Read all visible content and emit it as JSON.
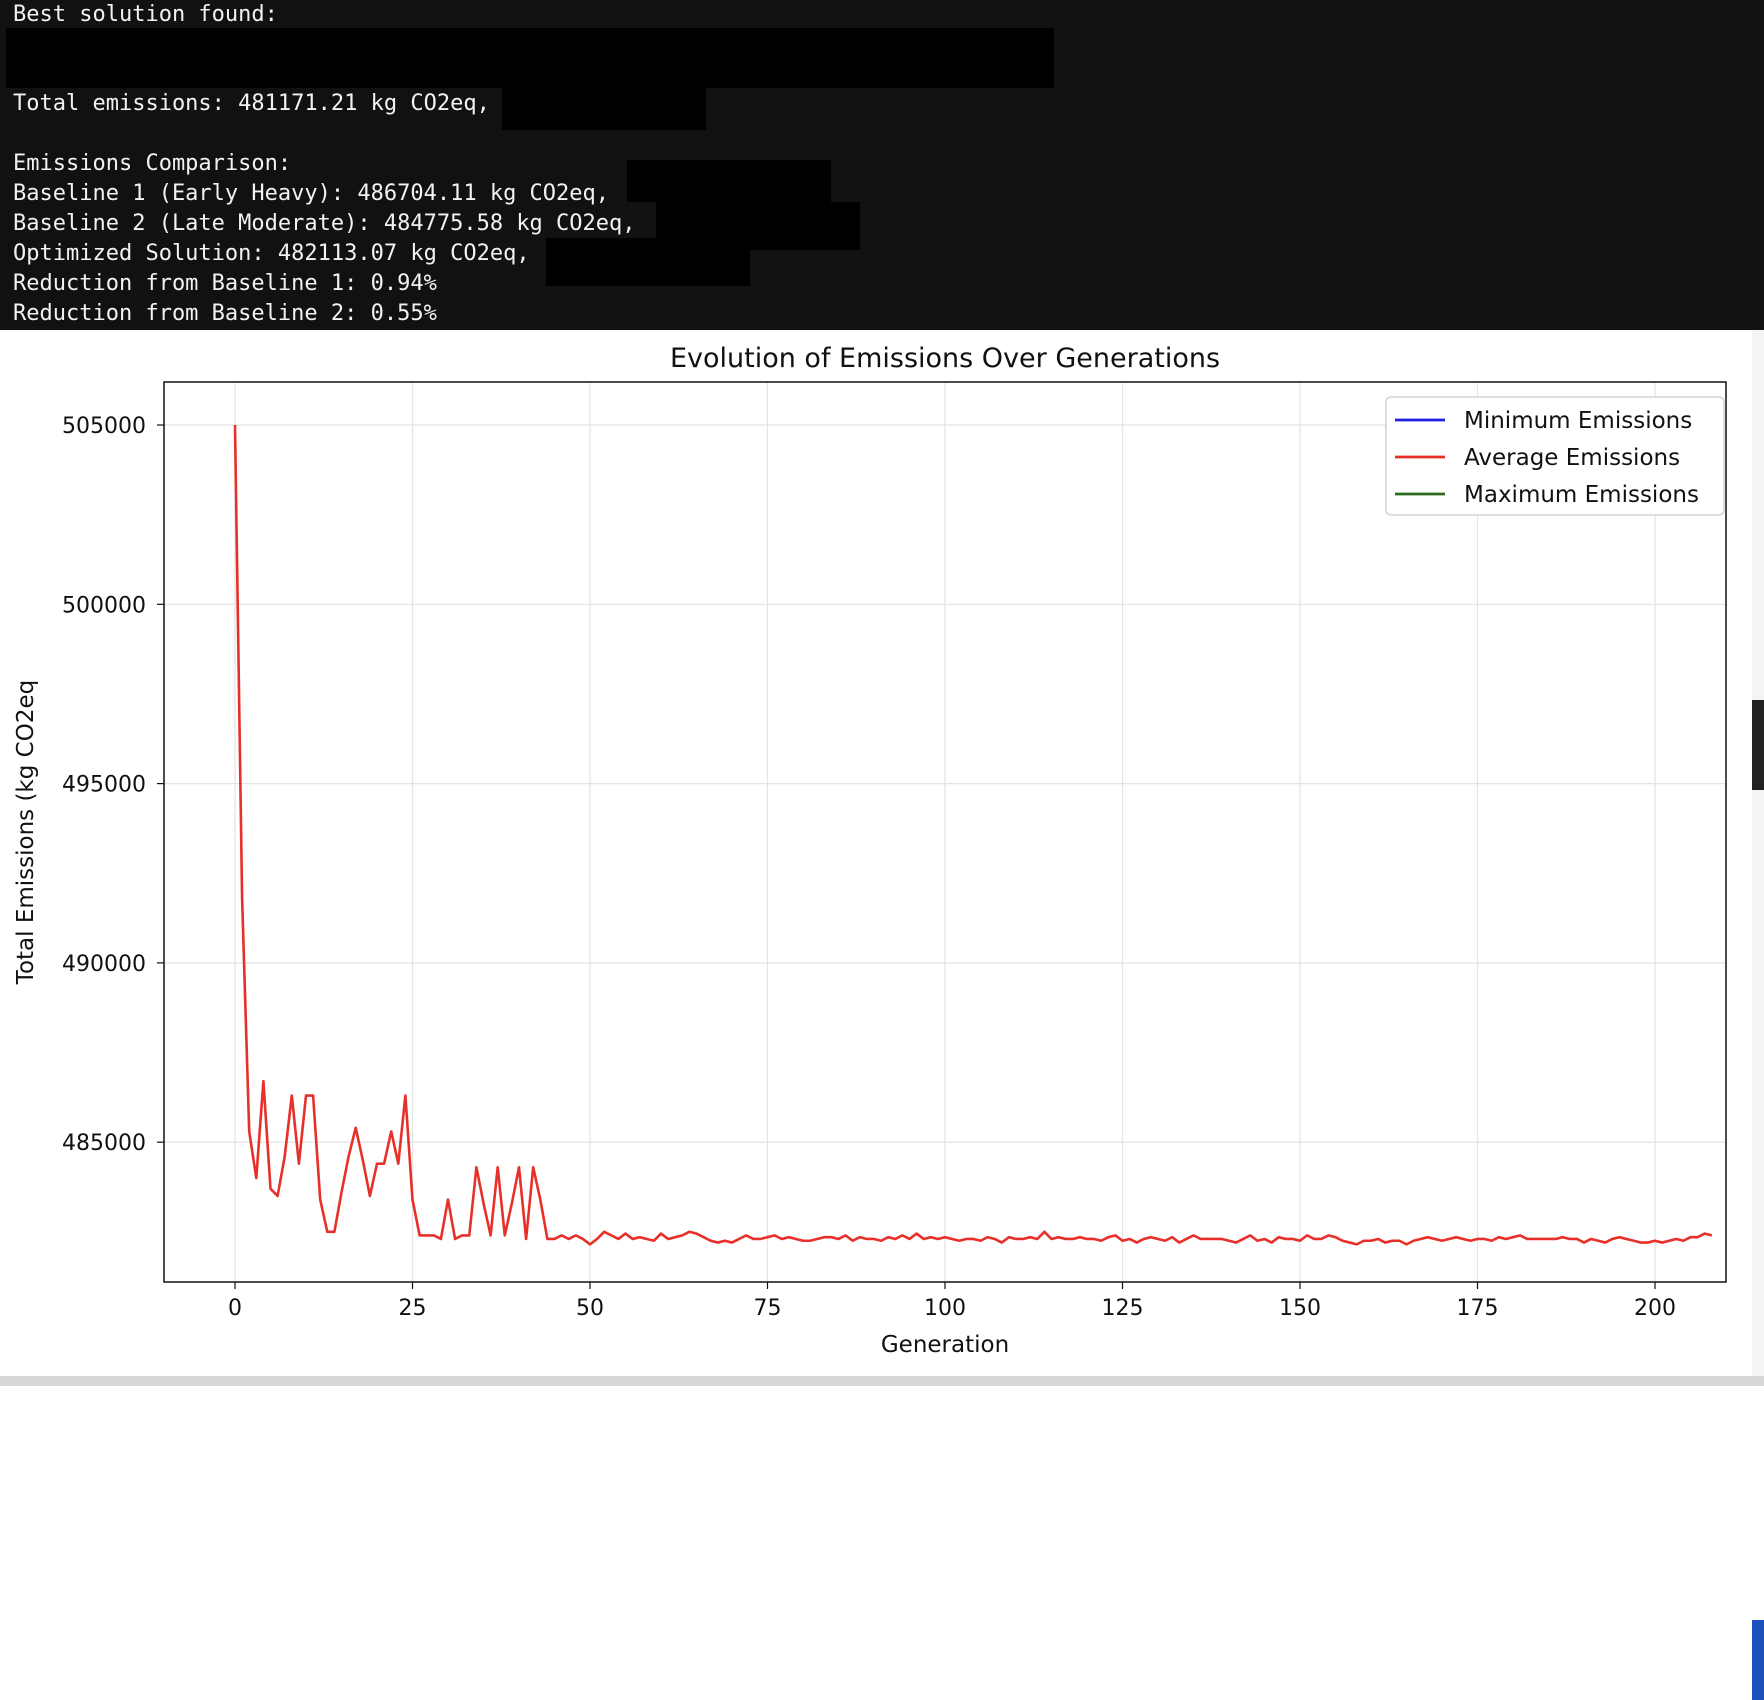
{
  "terminal": {
    "lines": [
      "Best solution found:",
      "Total emissions: 481171.21 kg CO2eq,",
      "Emissions Comparison:",
      "Baseline 1 (Early Heavy): 486704.11 kg CO2eq,",
      "Baseline 2 (Late Moderate): 484775.58 kg CO2eq,",
      "Optimized Solution: 482113.07 kg CO2eq,",
      "Reduction from Baseline 1: 0.94%",
      "Reduction from Baseline 2: 0.55%"
    ]
  },
  "chart_data": {
    "type": "line",
    "title": "Evolution of Emissions Over Generations",
    "xlabel": "Generation",
    "ylabel": "Total Emissions (kg CO2eq",
    "xlim": [
      -10,
      210
    ],
    "ylim": [
      481100,
      506200
    ],
    "xticks": [
      0,
      25,
      50,
      75,
      100,
      125,
      150,
      175,
      200
    ],
    "xtick_labels": [
      "0",
      "25",
      "50",
      "75",
      "100",
      "125",
      "150",
      "175",
      "200"
    ],
    "yticks": [
      485000,
      490000,
      495000,
      500000,
      505000
    ],
    "ytick_labels": [
      "485000",
      "490000",
      "495000",
      "500000",
      "505000"
    ],
    "grid": true,
    "legend_position": "top-right",
    "legend": [
      {
        "name": "Minimum Emissions",
        "color": "#1f1fe0"
      },
      {
        "name": "Average Emissions",
        "color": "#e8302a"
      },
      {
        "name": "Maximum Emissions",
        "color": "#2e6b1e"
      }
    ],
    "series": [
      {
        "name": "Average Emissions",
        "color": "#e8302a",
        "x_start": 0,
        "x_step": 1,
        "values": [
          505000,
          491800,
          485300,
          484000,
          486700,
          483700,
          483500,
          484600,
          486300,
          484400,
          486300,
          486300,
          483400,
          482500,
          482500,
          483600,
          484600,
          485400,
          484500,
          483500,
          484400,
          484400,
          485300,
          484400,
          486300,
          483400,
          482400,
          482400,
          482400,
          482300,
          483400,
          482300,
          482400,
          482400,
          484300,
          483300,
          482400,
          484300,
          482400,
          483300,
          484300,
          482300,
          484300,
          483400,
          482300,
          482300,
          482400,
          482300,
          482400,
          482300,
          482150,
          482300,
          482500,
          482400,
          482300,
          482450,
          482300,
          482350,
          482300,
          482250,
          482450,
          482300,
          482350,
          482400,
          482500,
          482450,
          482350,
          482250,
          482200,
          482250,
          482200,
          482300,
          482400,
          482300,
          482300,
          482350,
          482400,
          482300,
          482350,
          482300,
          482250,
          482250,
          482300,
          482350,
          482350,
          482300,
          482400,
          482250,
          482350,
          482300,
          482300,
          482250,
          482350,
          482300,
          482400,
          482300,
          482450,
          482300,
          482350,
          482300,
          482350,
          482300,
          482250,
          482300,
          482300,
          482250,
          482350,
          482300,
          482200,
          482350,
          482300,
          482300,
          482350,
          482300,
          482500,
          482300,
          482350,
          482300,
          482300,
          482350,
          482300,
          482300,
          482250,
          482350,
          482400,
          482250,
          482300,
          482200,
          482300,
          482350,
          482300,
          482250,
          482350,
          482200,
          482300,
          482400,
          482300,
          482300,
          482300,
          482300,
          482250,
          482200,
          482300,
          482400,
          482250,
          482300,
          482200,
          482350,
          482300,
          482300,
          482250,
          482400,
          482300,
          482300,
          482400,
          482350,
          482250,
          482200,
          482150,
          482250,
          482250,
          482300,
          482200,
          482250,
          482250,
          482150,
          482250,
          482300,
          482350,
          482300,
          482250,
          482300,
          482350,
          482300,
          482250,
          482300,
          482300,
          482250,
          482350,
          482300,
          482350,
          482400,
          482300,
          482300,
          482300,
          482300,
          482300,
          482350,
          482300,
          482300,
          482200,
          482300,
          482250,
          482200,
          482300,
          482350,
          482300,
          482250,
          482200,
          482200,
          482250,
          482200,
          482250,
          482300,
          482250,
          482350,
          482350,
          482450,
          482400
        ]
      }
    ]
  }
}
